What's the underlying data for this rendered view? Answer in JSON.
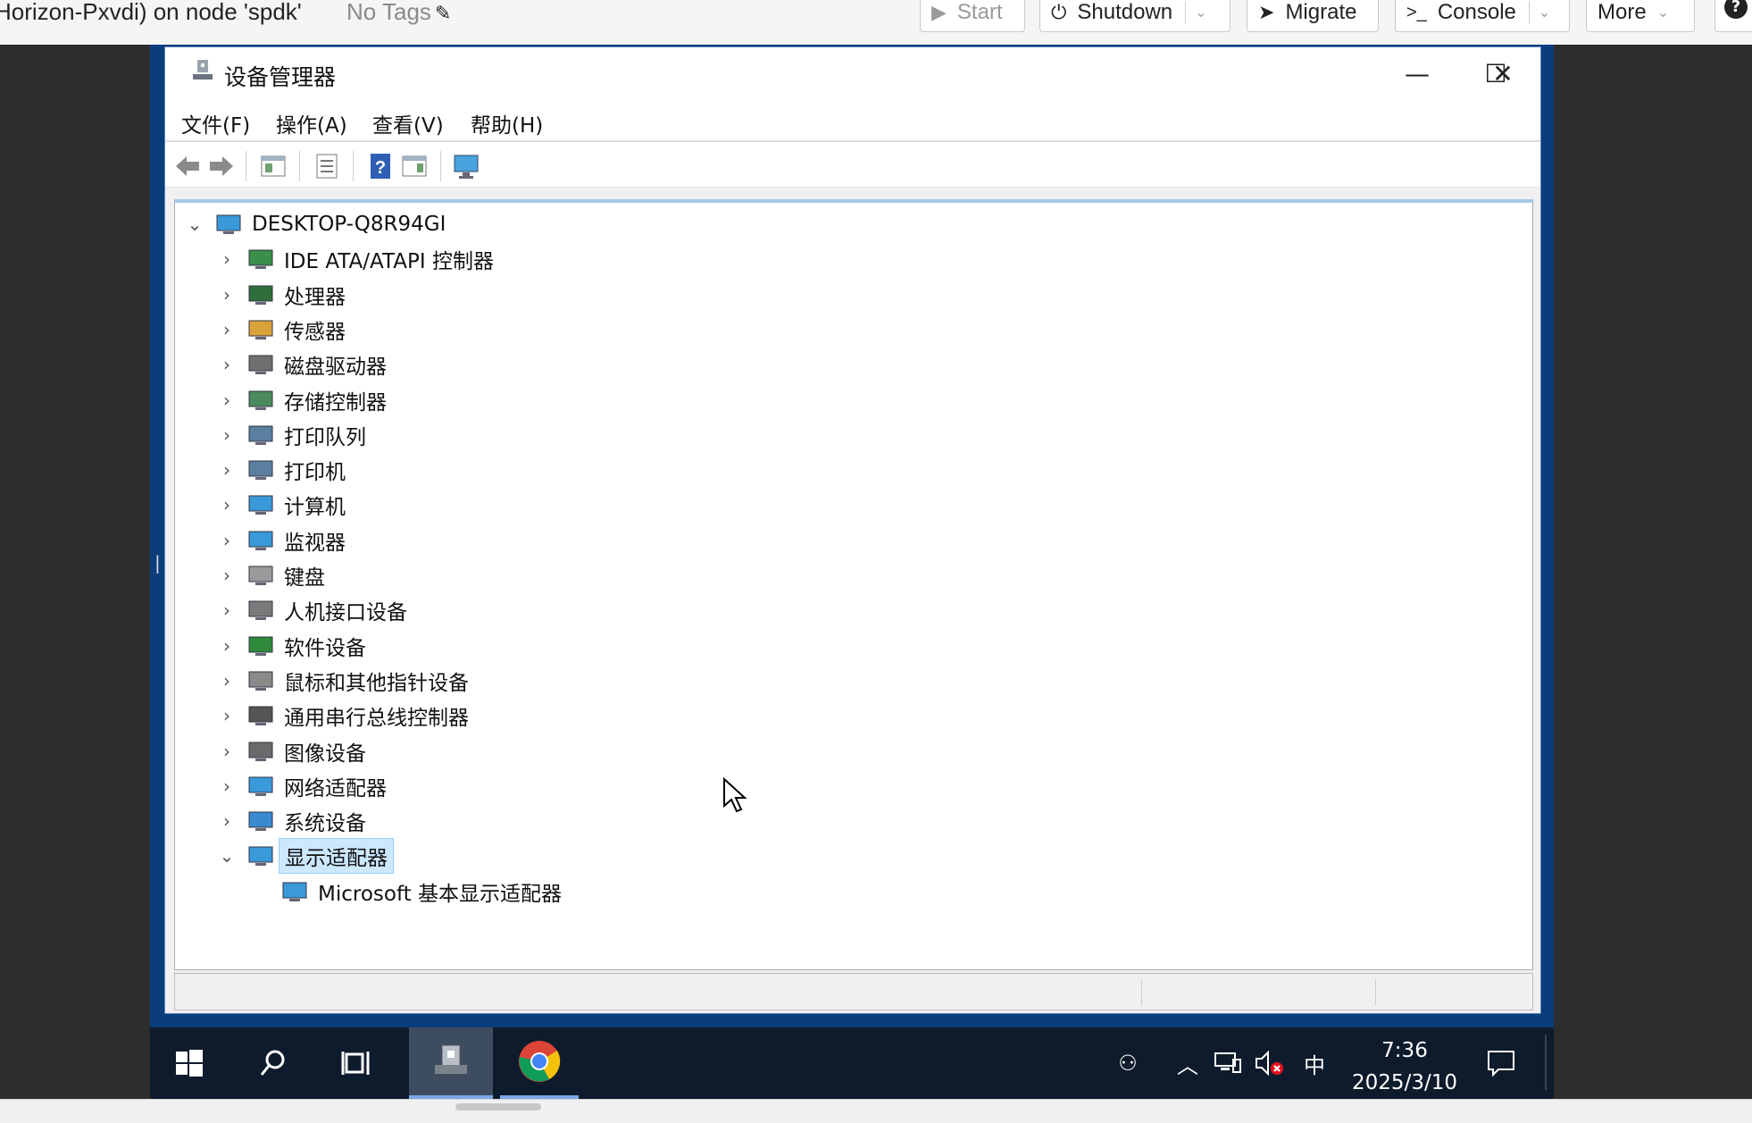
{
  "proxmox": {
    "vm_title": "Horizon-Pxvdi) on node 'spdk'",
    "tags": "No Tags",
    "buttons": {
      "start": "Start",
      "shutdown": "Shutdown",
      "migrate": "Migrate",
      "console": "Console",
      "more": "More"
    }
  },
  "window": {
    "title": "设备管理器",
    "controls": {
      "minimize": "—",
      "maximize": "☐",
      "close": "✕"
    },
    "menu": [
      "文件(F)",
      "操作(A)",
      "查看(V)",
      "帮助(H)"
    ],
    "toolbar_icons": [
      "back-icon",
      "forward-icon",
      "show-hide-console-tree-icon",
      "properties-icon",
      "help-icon",
      "action-pane-icon",
      "scan-hardware-icon"
    ]
  },
  "tree": {
    "root": {
      "label": "DESKTOP-Q8R94GI",
      "expanded": true
    },
    "categories": [
      {
        "label": "IDE ATA/ATAPI 控制器",
        "icon": "ide-controller-icon",
        "expanded": false
      },
      {
        "label": "处理器",
        "icon": "processor-icon",
        "expanded": false
      },
      {
        "label": "传感器",
        "icon": "sensor-icon",
        "expanded": false
      },
      {
        "label": "磁盘驱动器",
        "icon": "disk-drive-icon",
        "expanded": false
      },
      {
        "label": "存储控制器",
        "icon": "storage-controller-icon",
        "expanded": false
      },
      {
        "label": "打印队列",
        "icon": "print-queue-icon",
        "expanded": false
      },
      {
        "label": "打印机",
        "icon": "printer-icon",
        "expanded": false
      },
      {
        "label": "计算机",
        "icon": "computer-icon",
        "expanded": false
      },
      {
        "label": "监视器",
        "icon": "monitor-icon",
        "expanded": false
      },
      {
        "label": "键盘",
        "icon": "keyboard-icon",
        "expanded": false
      },
      {
        "label": "人机接口设备",
        "icon": "hid-icon",
        "expanded": false
      },
      {
        "label": "软件设备",
        "icon": "software-device-icon",
        "expanded": false
      },
      {
        "label": "鼠标和其他指针设备",
        "icon": "mouse-icon",
        "expanded": false
      },
      {
        "label": "通用串行总线控制器",
        "icon": "usb-icon",
        "expanded": false
      },
      {
        "label": "图像设备",
        "icon": "imaging-device-icon",
        "expanded": false
      },
      {
        "label": "网络适配器",
        "icon": "network-adapter-icon",
        "expanded": false
      },
      {
        "label": "系统设备",
        "icon": "system-device-icon",
        "expanded": false
      },
      {
        "label": "显示适配器",
        "icon": "display-adapter-icon",
        "expanded": true,
        "selected": true
      }
    ],
    "display_children": [
      {
        "label": "Microsoft 基本显示适配器",
        "icon": "display-adapter-icon"
      }
    ]
  },
  "taskbar": {
    "ime": "中",
    "time": "7:36",
    "date": "2025/3/10"
  },
  "colors": {
    "selection_bg": "#cce8ff",
    "taskbar_bg": "#0e1b2c",
    "desktop_bg": "#0b3c7c"
  }
}
